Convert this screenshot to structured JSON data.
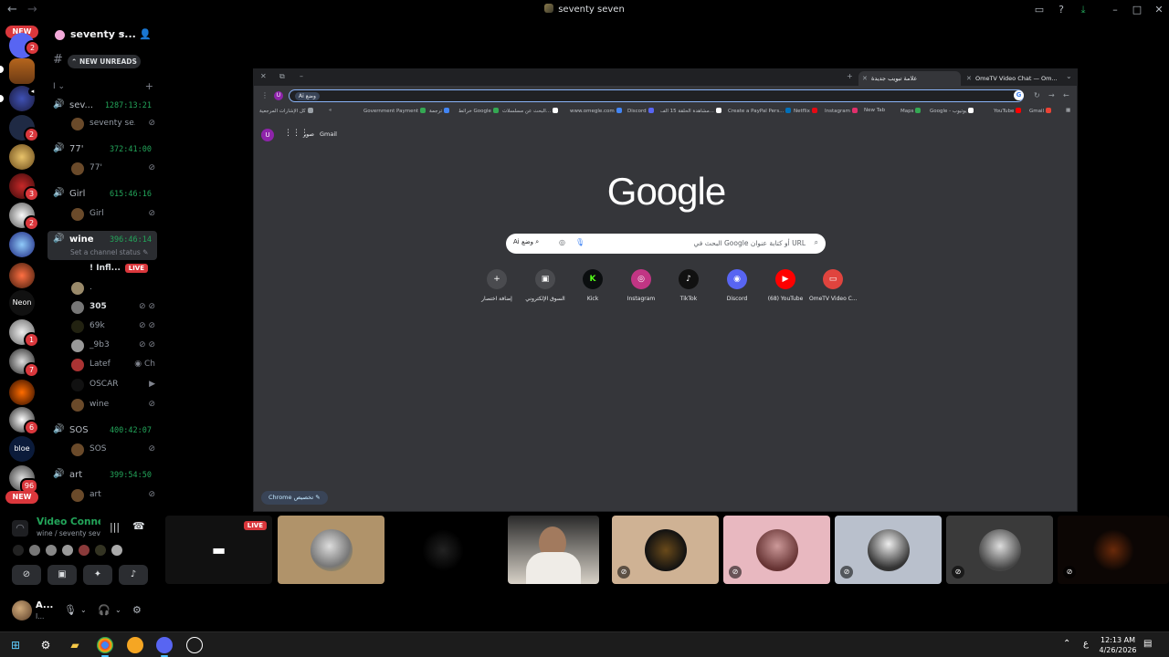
{
  "window": {
    "title": "seventy seven"
  },
  "rail": {
    "new_top": "NEW",
    "new_bottom": "NEW",
    "badges": [
      "2",
      "2",
      "3",
      "2",
      "1",
      "7",
      "6",
      "96"
    ],
    "neon_label": "Neon",
    "bloe_label": "bloe"
  },
  "server": {
    "name": "seventy s...",
    "new_unreads": "NEW UNREADS",
    "category": "I"
  },
  "channels": [
    {
      "name": "sev...",
      "time": "1287:13:21"
    },
    {
      "name": "77'",
      "time": "372:41:00"
    },
    {
      "name": "Girl",
      "time": "615:46:16"
    },
    {
      "name": "wine",
      "time": "396:46:14",
      "status": "Set a channel status"
    },
    {
      "name": "SOS",
      "time": "400:42:07"
    },
    {
      "name": "art",
      "time": "399:54:50"
    }
  ],
  "members": {
    "sev": "seventy se...",
    "s77": "77'",
    "girl": "Girl",
    "wine": [
      {
        "name": "! Infl...",
        "live": "LIVE"
      },
      {
        "name": "."
      },
      {
        "name": "305"
      },
      {
        "name": "69k"
      },
      {
        "name": "_9b3"
      },
      {
        "name": "Latef",
        "extra": "Ch"
      },
      {
        "name": "OSCAR"
      },
      {
        "name": "wine"
      }
    ],
    "sos": "SOS",
    "art": "art"
  },
  "voice": {
    "title": "Video Connected",
    "subtitle": "wine / seventy sev...",
    "user_name": "A...",
    "user_sub": "I..."
  },
  "chrome": {
    "tabs": [
      {
        "label": "علامة تبويب جديدة"
      },
      {
        "label": "OmeTV Video Chat — Om..."
      }
    ],
    "omnibox_ai": "Ai وضع",
    "bookmarks": [
      "كل الإشارات المرجعية",
      "Government Payment",
      "ترجمة",
      "خرائط Google",
      "البحث عن مسلسلات...",
      "www.omegle.com",
      "Discord",
      "مشاهدة الحلقة 15 الف...",
      "Create a PayPal Pers...",
      "Netflix",
      "Instagram",
      "New Tab",
      "Maps",
      "Google - يوتيوب",
      "YouTube",
      "Gmail"
    ],
    "top_links": {
      "images": "صور",
      "gmail": "Gmail",
      "avatar": "U"
    },
    "logo": "Google",
    "search_placeholder": "البحث في Google أو كتابة عنوان URL",
    "search_ai": "Ai وضع",
    "shortcuts": [
      {
        "label": "إضافة اختصار",
        "icon": "+"
      },
      {
        "label": "السوق الإلكتروني",
        "icon": "▣"
      },
      {
        "label": "Kick",
        "icon": "K"
      },
      {
        "label": "Instagram",
        "icon": "◎"
      },
      {
        "label": "TikTok",
        "icon": "♪"
      },
      {
        "label": "Discord",
        "icon": "◉"
      },
      {
        "label": "(68) YouTube",
        "icon": "▶"
      },
      {
        "label": "OmeTV Video C...",
        "icon": "▭"
      }
    ],
    "customize": "Chrome تخصيص"
  },
  "tiles": {
    "live": "LIVE"
  },
  "taskbar": {
    "time": "12:13 AM",
    "date": "4/26/2026",
    "lang": "ع"
  },
  "colors": {
    "discord_green": "#23a55a",
    "discord_red": "#da373c",
    "chrome_bg": "#35363a"
  }
}
